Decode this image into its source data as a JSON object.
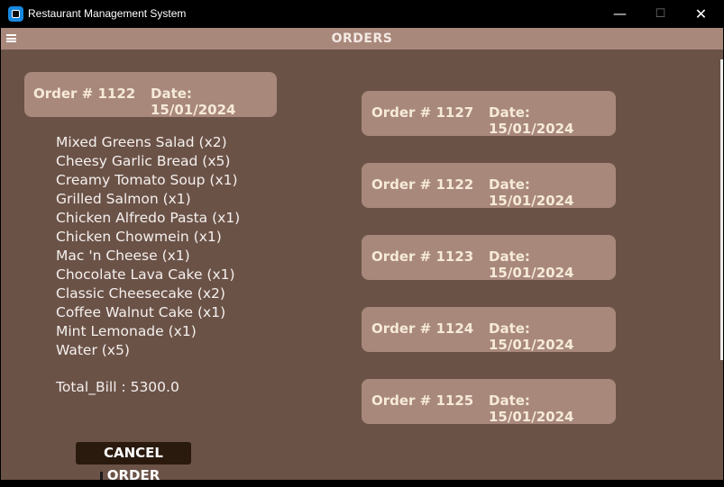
{
  "window": {
    "title": "Restaurant Management System",
    "controls": {
      "minimize": "—",
      "maximize": "☐",
      "close": "✕"
    }
  },
  "header": {
    "title": "ORDERS"
  },
  "selected_order": {
    "number": "Order # 1122",
    "date": "Date: 15/01/2024",
    "items": [
      "Mixed Greens Salad (x2)",
      "Cheesy Garlic Bread (x5)",
      "Creamy Tomato Soup (x1)",
      "Grilled Salmon (x1)",
      "Chicken Alfredo Pasta (x1)",
      "Chicken Chowmein (x1)",
      "Mac 'n Cheese (x1)",
      "Chocolate Lava Cake (x1)",
      "Classic Cheesecake (x2)",
      "Coffee Walnut Cake (x1)",
      "Mint Lemonade (x1)",
      "Water (x5)"
    ],
    "total": "Total_Bill : 5300.0"
  },
  "orders": [
    {
      "number": "Order # 1127",
      "date": "Date: 15/01/2024"
    },
    {
      "number": "Order # 1122",
      "date": "Date: 15/01/2024"
    },
    {
      "number": "Order # 1123",
      "date": "Date: 15/01/2024"
    },
    {
      "number": "Order # 1124",
      "date": "Date: 15/01/2024"
    },
    {
      "number": "Order # 1125",
      "date": "Date: 15/01/2024"
    }
  ],
  "actions": {
    "cancel_label": "CANCEL ORDER"
  },
  "colors": {
    "background": "#6b5247",
    "card": "#a9887c",
    "card_text": "#f6ead8",
    "button": "#2a1a0e"
  }
}
